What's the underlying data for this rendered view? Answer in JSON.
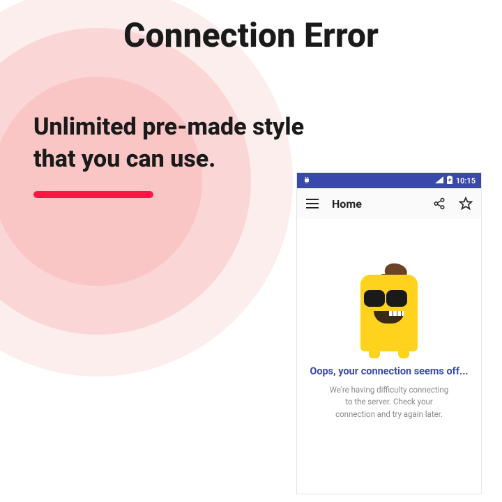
{
  "main": {
    "title": "Connection Error",
    "subtitle_line1": "Unlimited pre-made style",
    "subtitle_line2": "that you can use."
  },
  "phone": {
    "status": {
      "time": "10:15"
    },
    "appbar": {
      "title": "Home"
    },
    "error": {
      "title": "Oops, your connection seems off...",
      "description": "We're having difficulty connecting to the server. Check your connection and try again later."
    }
  }
}
